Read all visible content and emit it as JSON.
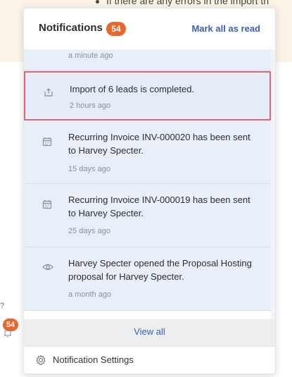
{
  "background": {
    "bullet_text": "If there are any errors in the import th",
    "question_mark": "?",
    "badge_count": "54"
  },
  "panel": {
    "title": "Notifications",
    "count": "54",
    "mark_all_label": "Mark all as read"
  },
  "notifications": [
    {
      "text": "",
      "time": "a minute ago",
      "icon": "none"
    },
    {
      "text": "Import of 6 leads is completed.",
      "time": "2 hours ago",
      "icon": "upload-icon"
    },
    {
      "text": "Recurring Invoice INV-000020 has been sent to Harvey Specter.",
      "time": "15 days ago",
      "icon": "calendar-icon"
    },
    {
      "text": "Recurring Invoice INV-000019 has been sent to Harvey Specter.",
      "time": "25 days ago",
      "icon": "calendar-icon"
    },
    {
      "text": "Harvey Specter opened the Proposal Hosting proposal for Harvey Specter.",
      "time": "a month ago",
      "icon": "eye-icon"
    }
  ],
  "view_all_label": "View all",
  "footer": {
    "settings_label": "Notification Settings"
  },
  "colors": {
    "accent": "#3a5fb5",
    "badge": "#e8672a",
    "highlight_border": "#e06677",
    "item_bg": "#e9eff8"
  }
}
